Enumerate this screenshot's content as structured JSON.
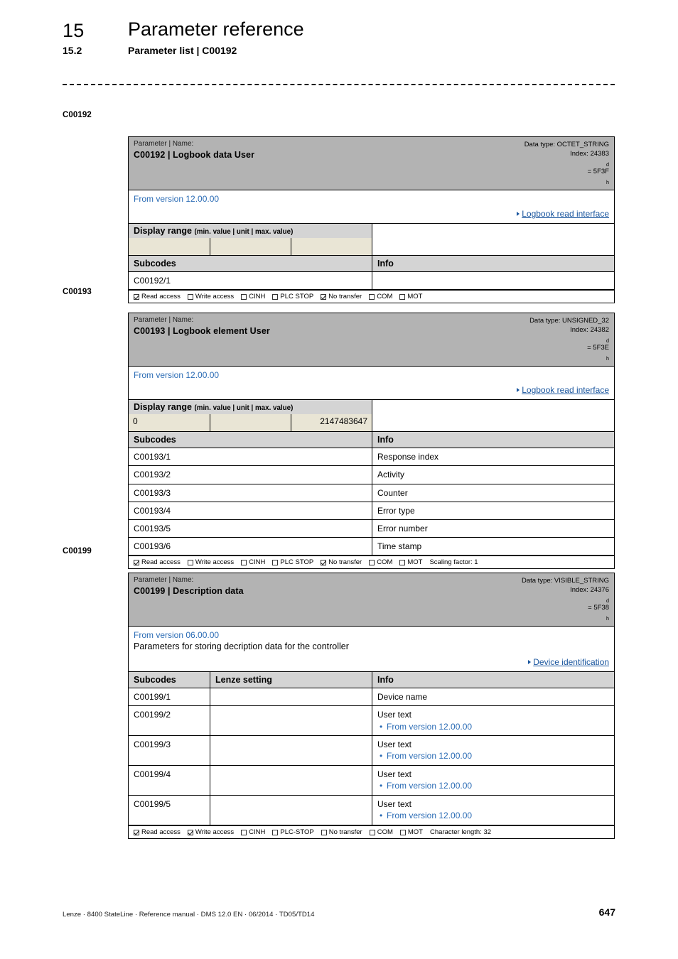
{
  "header": {
    "chapter_number": "15",
    "chapter_title": "Parameter reference",
    "section_number": "15.2",
    "section_title": "Parameter list | C00192"
  },
  "footer": {
    "text": "Lenze · 8400 StateLine · Reference manual · DMS 12.0 EN · 06/2014 · TD05/TD14",
    "page_number": "647"
  },
  "colors": {
    "title_band": "#b3b3b3",
    "head_band": "#d4d4d4",
    "value_cell": "#e9e5d5",
    "link": "#19559e",
    "version_text": "#2b6cb5"
  },
  "blocks": [
    {
      "margin_label": "C00192",
      "kicker": "Parameter | Name:",
      "name": "C00192 | Logbook data User",
      "data_type": "Data type: OCTET_STRING",
      "index_prefix": "Index: 24383",
      "index_sub1": "d",
      "index_mid": " = 5F3F",
      "index_sub2": "h",
      "version": "From version 12.00.00",
      "description": "",
      "link": "Logbook read interface",
      "display_range": {
        "title": "Display range",
        "note": "(min. value | unit | max. value)",
        "min": "",
        "unit": "",
        "max": ""
      },
      "columns": [
        "Subcodes",
        "Info"
      ],
      "rows": [
        {
          "subcode": "C00192/1",
          "info": "",
          "info_sub": ""
        }
      ],
      "flags": [
        {
          "label": "Read access",
          "checked": true
        },
        {
          "label": "Write access",
          "checked": false
        },
        {
          "label": "CINH",
          "checked": false
        },
        {
          "label": "PLC STOP",
          "checked": false
        },
        {
          "label": "No transfer",
          "checked": true
        },
        {
          "label": "COM",
          "checked": false
        },
        {
          "label": "MOT",
          "checked": false
        }
      ],
      "flag_extra": ""
    },
    {
      "margin_label": "C00193",
      "kicker": "Parameter | Name:",
      "name": "C00193 | Logbook element User",
      "data_type": "Data type: UNSIGNED_32",
      "index_prefix": "Index: 24382",
      "index_sub1": "d",
      "index_mid": " = 5F3E",
      "index_sub2": "h",
      "version": "From version 12.00.00",
      "description": "",
      "link": "Logbook read interface",
      "display_range": {
        "title": "Display range",
        "note": "(min. value | unit | max. value)",
        "min": "0",
        "unit": "",
        "max": "2147483647"
      },
      "columns": [
        "Subcodes",
        "Info"
      ],
      "rows": [
        {
          "subcode": "C00193/1",
          "info": "Response index",
          "info_sub": ""
        },
        {
          "subcode": "C00193/2",
          "info": "Activity",
          "info_sub": ""
        },
        {
          "subcode": "C00193/3",
          "info": "Counter",
          "info_sub": ""
        },
        {
          "subcode": "C00193/4",
          "info": "Error type",
          "info_sub": ""
        },
        {
          "subcode": "C00193/5",
          "info": "Error number",
          "info_sub": ""
        },
        {
          "subcode": "C00193/6",
          "info": "Time stamp",
          "info_sub": ""
        }
      ],
      "flags": [
        {
          "label": "Read access",
          "checked": true
        },
        {
          "label": "Write access",
          "checked": false
        },
        {
          "label": "CINH",
          "checked": false
        },
        {
          "label": "PLC STOP",
          "checked": false
        },
        {
          "label": "No transfer",
          "checked": true
        },
        {
          "label": "COM",
          "checked": false
        },
        {
          "label": "MOT",
          "checked": false
        }
      ],
      "flag_extra": "Scaling factor: 1"
    },
    {
      "margin_label": "C00199",
      "kicker": "Parameter | Name:",
      "name": "C00199 | Description data",
      "data_type": "Data type: VISIBLE_STRING",
      "index_prefix": "Index: 24376",
      "index_sub1": "d",
      "index_mid": " = 5F38",
      "index_sub2": "h",
      "version": "From version 06.00.00",
      "description": "Parameters for storing decription data for the controller",
      "link": "Device identification",
      "display_range": null,
      "columns": [
        "Subcodes",
        "Lenze setting",
        "Info"
      ],
      "rows": [
        {
          "subcode": "C00199/1",
          "lenze": "",
          "info": "Device name",
          "info_sub": ""
        },
        {
          "subcode": "C00199/2",
          "lenze": "",
          "info": "User text",
          "info_sub": "From version 12.00.00"
        },
        {
          "subcode": "C00199/3",
          "lenze": "",
          "info": "User text",
          "info_sub": "From version 12.00.00"
        },
        {
          "subcode": "C00199/4",
          "lenze": "",
          "info": "User text",
          "info_sub": "From version 12.00.00"
        },
        {
          "subcode": "C00199/5",
          "lenze": "",
          "info": "User text",
          "info_sub": "From version 12.00.00"
        }
      ],
      "flags": [
        {
          "label": "Read access",
          "checked": true
        },
        {
          "label": "Write access",
          "checked": true
        },
        {
          "label": "CINH",
          "checked": false
        },
        {
          "label": "PLC-STOP",
          "checked": false
        },
        {
          "label": "No transfer",
          "checked": false
        },
        {
          "label": "COM",
          "checked": false
        },
        {
          "label": "MOT",
          "checked": false
        }
      ],
      "flag_extra": "Character length: 32"
    }
  ]
}
